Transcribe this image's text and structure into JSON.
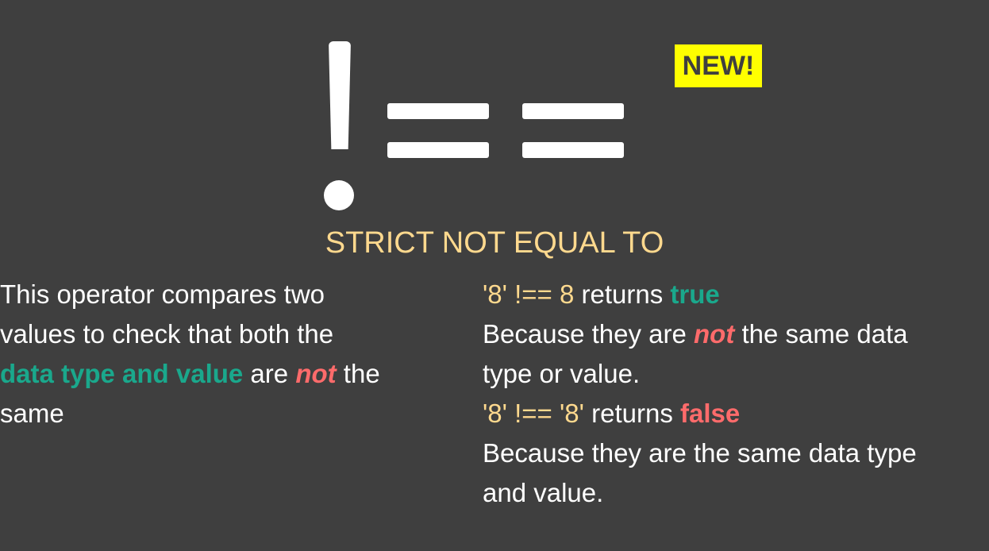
{
  "badge": {
    "label": "NEW!",
    "color": "#ffff00"
  },
  "operator_symbol_icon": "strict-not-equal-icon",
  "title": "STRICT NOT EQUAL TO",
  "description": {
    "line1": "This operator compares two",
    "line2": "values to check that both the",
    "line3_highlight": "data type and value",
    "line3_mid": " are ",
    "line3_emph": "not",
    "line3_end": " the",
    "line4": "same"
  },
  "example1": {
    "code": "'8' !== 8",
    "returns_label": " returns ",
    "result": "true",
    "explain_pre": "Because they are ",
    "explain_emph": "not",
    "explain_post": " the same data",
    "explain_line2": "type or value."
  },
  "example2": {
    "code": "'8' !== '8'",
    "returns_label": " returns ",
    "result": "false",
    "explain_line1": "Because they are the same data type",
    "explain_line2": "and value."
  },
  "colors": {
    "background": "#3f3f3f",
    "title": "#ffd98e",
    "teal": "#1aa88c",
    "red": "#ff6b6b"
  }
}
